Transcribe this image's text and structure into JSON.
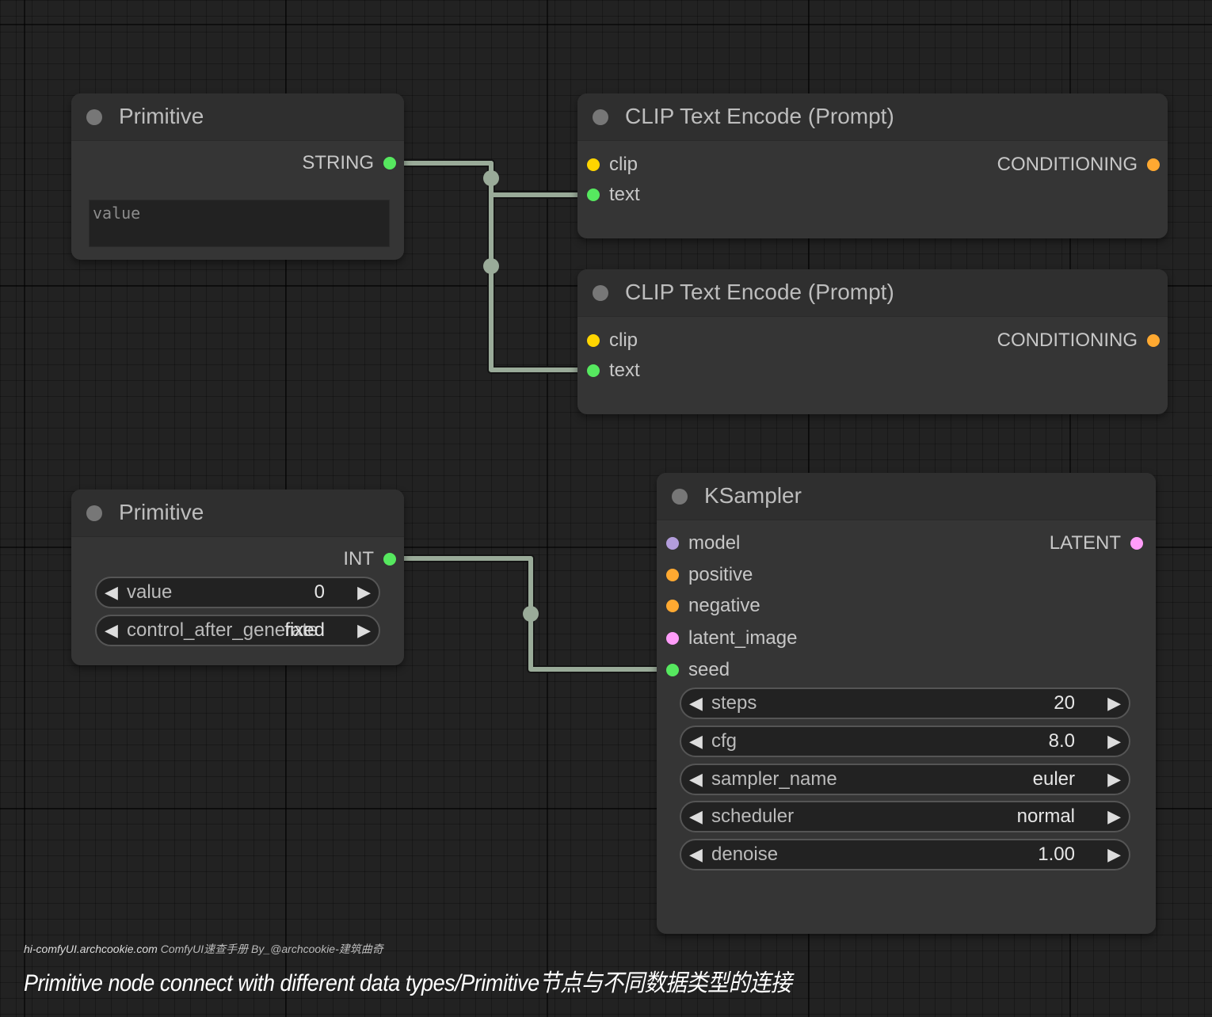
{
  "colors": {
    "canvas": "#222222",
    "node_body": "#353535",
    "node_header": "#2f2f2f",
    "link": "#9aab99",
    "slot_string": "#56e85f",
    "slot_int": "#56e85f",
    "slot_clip": "#ffd500",
    "slot_conditioning": "#ffa931",
    "slot_model": "#b39ddb",
    "slot_latent": "#ff9cf9"
  },
  "primitive_string": {
    "title": "Primitive",
    "output_label": "STRING",
    "value_placeholder": "value"
  },
  "clip_encode_1": {
    "title": "CLIP Text Encode (Prompt)",
    "input_clip": "clip",
    "input_text": "text",
    "output_label": "CONDITIONING"
  },
  "clip_encode_2": {
    "title": "CLIP Text Encode (Prompt)",
    "input_clip": "clip",
    "input_text": "text",
    "output_label": "CONDITIONING"
  },
  "primitive_int": {
    "title": "Primitive",
    "output_label": "INT",
    "widgets": [
      {
        "name": "value",
        "value": "0"
      },
      {
        "name": "control_after_generate",
        "value": "fixed"
      }
    ]
  },
  "ksampler": {
    "title": "KSampler",
    "inputs": [
      "model",
      "positive",
      "negative",
      "latent_image",
      "seed"
    ],
    "output_label": "LATENT",
    "widgets": [
      {
        "name": "steps",
        "value": "20"
      },
      {
        "name": "cfg",
        "value": "8.0"
      },
      {
        "name": "sampler_name",
        "value": "euler"
      },
      {
        "name": "scheduler",
        "value": "normal"
      },
      {
        "name": "denoise",
        "value": "1.00"
      }
    ]
  },
  "footer": {
    "site": "hi-comfyUI.archcookie.com",
    "credit": "ComfyUI速查手册 By_@archcookie-建筑曲奇",
    "caption": "Primitive node connect with different data types/Primitive节点与不同数据类型的连接"
  }
}
